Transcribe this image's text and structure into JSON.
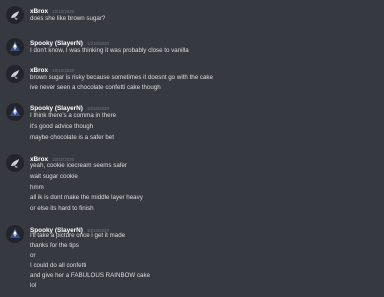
{
  "messages": [
    {
      "user": "xBrox",
      "timestamp": "10/10/2020",
      "avatar_icon": "xbrox-avatar-icon",
      "lines": [
        "does she like brown sugar?"
      ]
    },
    {
      "user": "Spooky (SlayerN)",
      "timestamp": "10/10/2020",
      "avatar_icon": "spooky-avatar-icon",
      "lines": [
        "I don't know, I was thinking it was probably close to vanilla"
      ]
    },
    {
      "user": "xBrox",
      "timestamp": "10/10/2020",
      "avatar_icon": "xbrox-avatar-icon",
      "lines": [
        "brown sugar is risky because sometimes it doesnt go with the cake",
        "ive never seen a chocolate confetti cake though"
      ]
    },
    {
      "user": "Spooky (SlayerN)",
      "timestamp": "10/10/2020",
      "avatar_icon": "spooky-avatar-icon",
      "lines": [
        "I think there's a comma in there",
        "it's good advice though",
        "maybe chocolate is a safer bet"
      ]
    },
    {
      "user": "xBrox",
      "timestamp": "10/10/2020",
      "avatar_icon": "xbrox-avatar-icon",
      "lines": [
        "yeah, cookie icecream seems safer",
        "wait sugar cookie",
        "hmm",
        "all ik is dont make the middle layer heavy",
        "or else its hard to finish"
      ]
    },
    {
      "user": "Spooky (SlayerN)",
      "timestamp": "10/10/2020",
      "avatar_icon": "spooky-avatar-icon",
      "lines": [
        "I'll take a picture once i get it made",
        "thanks for the tips",
        "or",
        "I could do all confetti",
        "and give her a FABULOUS RAINBOW cake",
        "lol"
      ]
    }
  ]
}
